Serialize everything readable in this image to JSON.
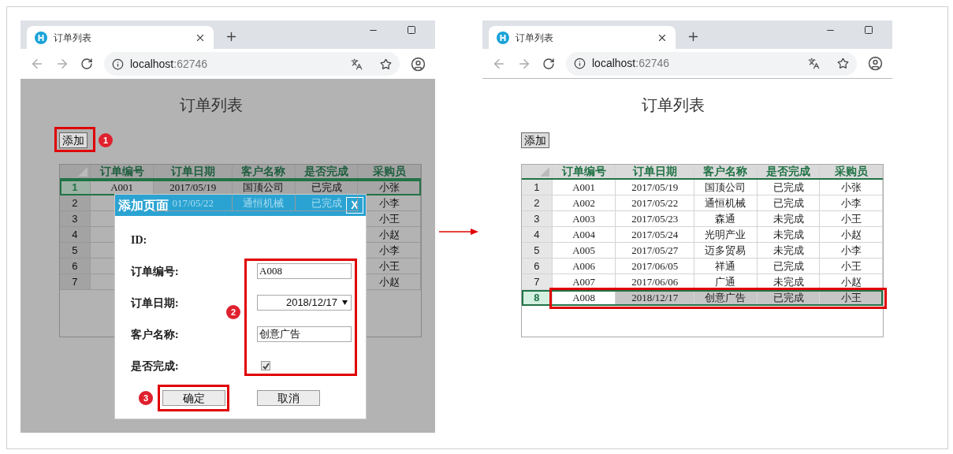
{
  "windows": [
    {
      "dimmed": true,
      "tab": {
        "title": "订单列表"
      },
      "address": {
        "host": "localhost",
        "port": ":62746"
      },
      "page": {
        "title": "订单列表",
        "add_button": "添加",
        "add_badge": "1",
        "table": {
          "columns": [
            "订单编号",
            "订单日期",
            "客户名称",
            "是否完成",
            "采购员"
          ],
          "rows": [
            {
              "number": "1",
              "selected": true,
              "highlighted": false,
              "order_id": "A001",
              "date": "2017/05/19",
              "customer": "国顶公司",
              "status": "已完成",
              "buyer": "小张"
            },
            {
              "number": "2",
              "selected": false,
              "highlighted": false,
              "date": "017/05/22",
              "customer": "通恒机械",
              "status": "已完成",
              "buyer": "小李"
            },
            {
              "number": "3",
              "selected": false,
              "highlighted": false,
              "buyer": "小王"
            },
            {
              "number": "4",
              "selected": false,
              "highlighted": false,
              "buyer": "小赵"
            },
            {
              "number": "5",
              "selected": false,
              "highlighted": false,
              "buyer": "小李"
            },
            {
              "number": "6",
              "selected": false,
              "highlighted": false,
              "buyer": "小王"
            },
            {
              "number": "7",
              "selected": false,
              "highlighted": false,
              "buyer": "小赵"
            }
          ]
        },
        "dialog": {
          "title": "添加页面",
          "close": "X",
          "fields_badge": "2",
          "confirm_badge": "3",
          "fields": [
            {
              "kind": "none",
              "label": "ID:"
            },
            {
              "kind": "text",
              "label": "订单编号:",
              "value": "A008"
            },
            {
              "kind": "select",
              "label": "订单日期:",
              "value": "2018/12/17"
            },
            {
              "kind": "text",
              "label": "客户名称:",
              "value": "创意广告"
            },
            {
              "kind": "checkbox",
              "label": "是否完成:",
              "checked": true
            }
          ],
          "buttons": [
            "确定",
            "取消"
          ]
        }
      }
    },
    {
      "dimmed": false,
      "tab": {
        "title": "订单列表"
      },
      "address": {
        "host": "localhost",
        "port": ":62746"
      },
      "page": {
        "title": "订单列表",
        "add_button": "添加",
        "table": {
          "columns": [
            "订单编号",
            "订单日期",
            "客户名称",
            "是否完成",
            "采购员"
          ],
          "rows": [
            {
              "number": "1",
              "selected": false,
              "highlighted": false,
              "order_id": "A001",
              "date": "2017/05/19",
              "customer": "国顶公司",
              "status": "已完成",
              "buyer": "小张"
            },
            {
              "number": "2",
              "selected": false,
              "highlighted": false,
              "order_id": "A002",
              "date": "2017/05/22",
              "customer": "通恒机械",
              "status": "已完成",
              "buyer": "小李"
            },
            {
              "number": "3",
              "selected": false,
              "highlighted": false,
              "order_id": "A003",
              "date": "2017/05/23",
              "customer": "森通",
              "status": "未完成",
              "buyer": "小王"
            },
            {
              "number": "4",
              "selected": false,
              "highlighted": false,
              "order_id": "A004",
              "date": "2017/05/24",
              "customer": "光明产业",
              "status": "未完成",
              "buyer": "小赵"
            },
            {
              "number": "5",
              "selected": false,
              "highlighted": false,
              "order_id": "A005",
              "date": "2017/05/27",
              "customer": "迈多贸易",
              "status": "未完成",
              "buyer": "小李"
            },
            {
              "number": "6",
              "selected": false,
              "highlighted": false,
              "order_id": "A006",
              "date": "2017/06/05",
              "customer": "祥通",
              "status": "已完成",
              "buyer": "小王"
            },
            {
              "number": "7",
              "selected": false,
              "highlighted": false,
              "order_id": "A007",
              "date": "2017/06/06",
              "customer": "广通",
              "status": "未完成",
              "buyer": "小赵"
            },
            {
              "number": "8",
              "selected": true,
              "highlighted": true,
              "order_id": "A008",
              "date": "2018/12/17",
              "customer": "创意广告",
              "status": "已完成",
              "buyer": "小王"
            }
          ]
        }
      }
    }
  ]
}
